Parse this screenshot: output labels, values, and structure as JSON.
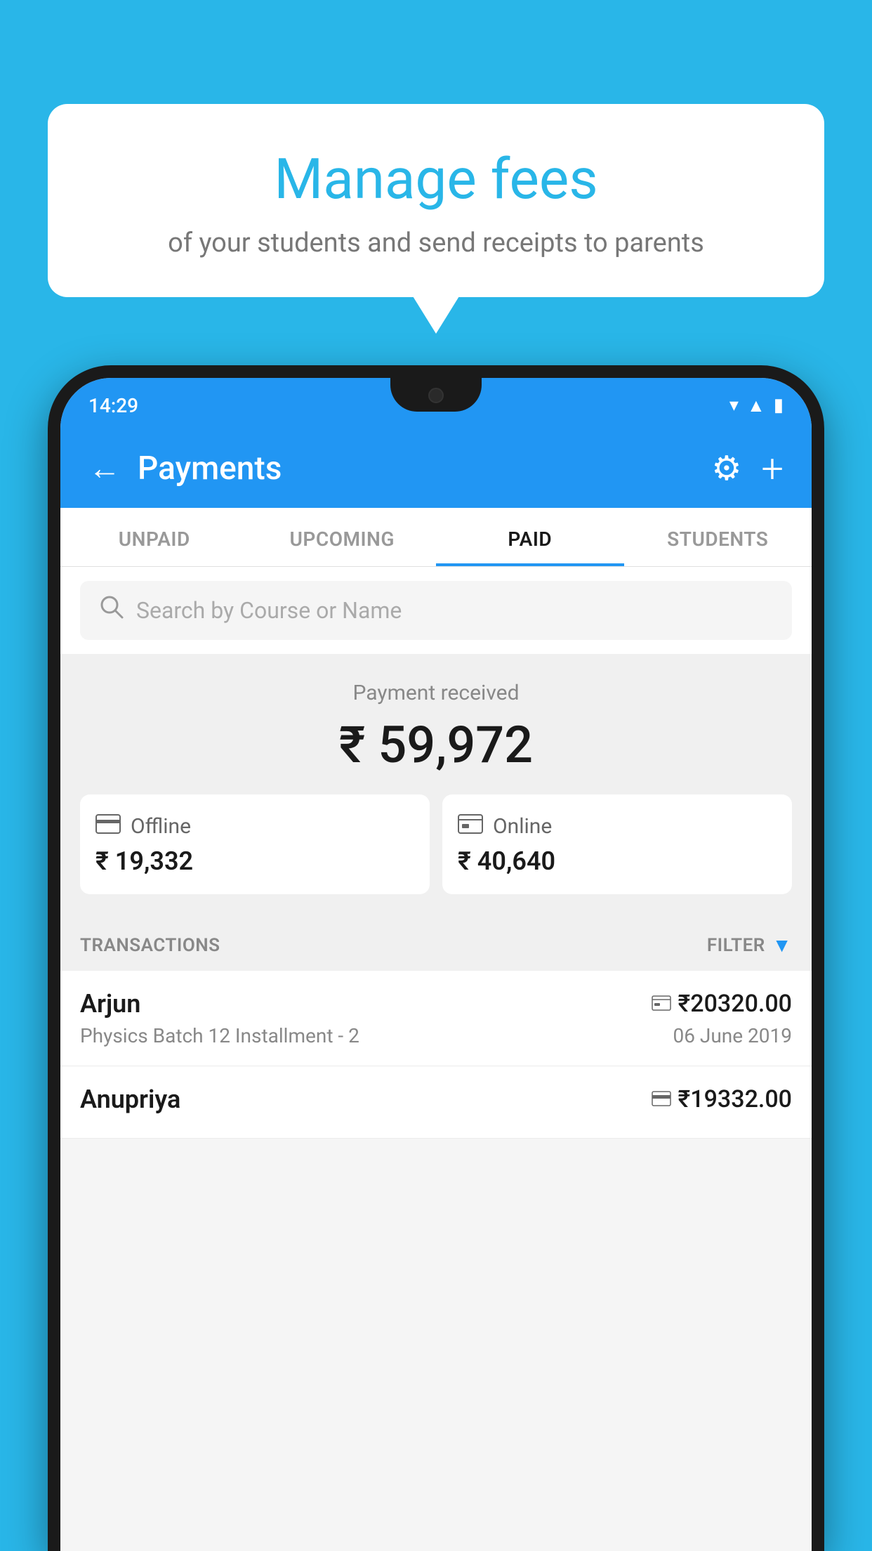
{
  "background": {
    "color": "#29b6e8"
  },
  "speech_bubble": {
    "title": "Manage fees",
    "subtitle": "of your students and send receipts to parents"
  },
  "status_bar": {
    "time": "14:29",
    "icons": [
      "wifi",
      "signal",
      "battery"
    ]
  },
  "header": {
    "title": "Payments",
    "back_label": "←",
    "settings_icon": "⚙",
    "add_icon": "+"
  },
  "tabs": [
    {
      "id": "unpaid",
      "label": "UNPAID",
      "active": false
    },
    {
      "id": "upcoming",
      "label": "UPCOMING",
      "active": false
    },
    {
      "id": "paid",
      "label": "PAID",
      "active": true
    },
    {
      "id": "students",
      "label": "STUDENTS",
      "active": false
    }
  ],
  "search": {
    "placeholder": "Search by Course or Name"
  },
  "payment_summary": {
    "label": "Payment received",
    "total": "₹ 59,972",
    "offline": {
      "icon": "💳",
      "label": "Offline",
      "amount": "₹ 19,332"
    },
    "online": {
      "icon": "💳",
      "label": "Online",
      "amount": "₹ 40,640"
    }
  },
  "transactions": {
    "header_label": "TRANSACTIONS",
    "filter_label": "FILTER",
    "rows": [
      {
        "name": "Arjun",
        "amount": "₹20320.00",
        "course": "Physics Batch 12 Installment - 2",
        "date": "06 June 2019",
        "payment_type": "online"
      },
      {
        "name": "Anupriya",
        "amount": "₹19332.00",
        "course": "",
        "date": "",
        "payment_type": "offline"
      }
    ]
  }
}
